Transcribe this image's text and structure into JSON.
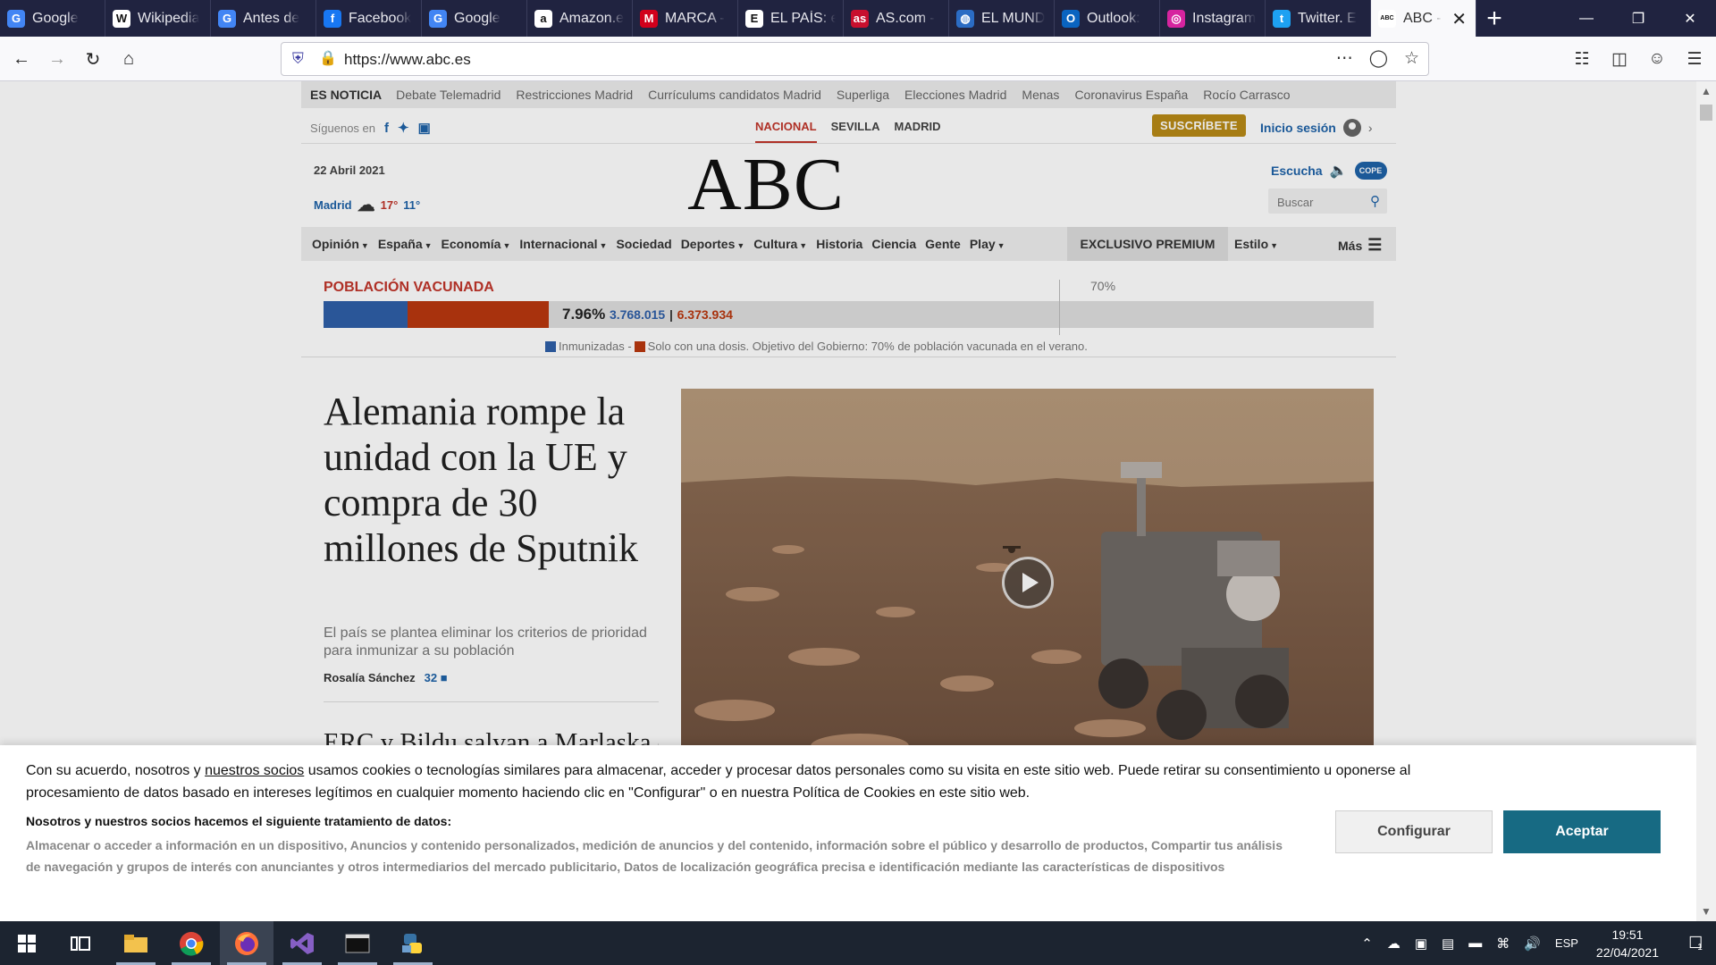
{
  "browser": {
    "tabs": [
      {
        "label": "Google",
        "icon": "google-icon",
        "color": "#4285f4",
        "glyph": "G"
      },
      {
        "label": "Wikipedia",
        "icon": "wikipedia-icon",
        "color": "#ffffff",
        "glyph": "W"
      },
      {
        "label": "Antes de",
        "icon": "google-icon",
        "color": "#4285f4",
        "glyph": "G"
      },
      {
        "label": "Facebook",
        "icon": "facebook-icon",
        "color": "#1877f2",
        "glyph": "f"
      },
      {
        "label": "Google",
        "icon": "google-icon",
        "color": "#4285f4",
        "glyph": "G"
      },
      {
        "label": "Amazon.e",
        "icon": "amazon-icon",
        "color": "#ffffff",
        "glyph": "a"
      },
      {
        "label": "MARCA -",
        "icon": "marca-icon",
        "color": "#d1001c",
        "glyph": "M"
      },
      {
        "label": "EL PAÍS: e",
        "icon": "elpais-icon",
        "color": "#ffffff",
        "glyph": "E"
      },
      {
        "label": "AS.com -",
        "icon": "as-icon",
        "color": "#c8102e",
        "glyph": "as"
      },
      {
        "label": "EL MUND",
        "icon": "globe-icon",
        "color": "#2b6cc4",
        "glyph": "◍"
      },
      {
        "label": "Outlook:",
        "icon": "outlook-icon",
        "color": "#0a64c0",
        "glyph": "O"
      },
      {
        "label": "Instagram",
        "icon": "instagram-icon",
        "color": "#d6249f",
        "glyph": "◎"
      },
      {
        "label": "Twitter. E",
        "icon": "twitter-icon",
        "color": "#1da1f2",
        "glyph": "t"
      },
      {
        "label": "ABC -",
        "icon": "abc-icon",
        "color": "#ffffff",
        "glyph": "ABC"
      }
    ],
    "url": "https://www.abc.es"
  },
  "ticker": {
    "label": "ES NOTICIA",
    "items": [
      "Debate Telemadrid",
      "Restricciones Madrid",
      "Currículums candidatos Madrid",
      "Superliga",
      "Elecciones Madrid",
      "Menas",
      "Coronavirus España",
      "Rocío Carrasco"
    ]
  },
  "social": {
    "follow_label": "Síguenos en"
  },
  "regions": [
    "NACIONAL",
    "SEVILLA",
    "MADRID"
  ],
  "subscribe_label": "SUSCRÍBETE",
  "login_label": "Inicio sesión",
  "masthead": {
    "date": "22 Abril 2021",
    "city": "Madrid",
    "temp_max": "17°",
    "temp_min": "11°",
    "logo": "ABC",
    "listen_label": "Escucha",
    "cope_label": "COPE",
    "search_placeholder": "Buscar"
  },
  "menu": {
    "items": [
      {
        "label": "Opinión",
        "dropdown": true
      },
      {
        "label": "España",
        "dropdown": true
      },
      {
        "label": "Economía",
        "dropdown": true
      },
      {
        "label": "Internacional",
        "dropdown": true
      },
      {
        "label": "Sociedad",
        "dropdown": false
      },
      {
        "label": "Deportes",
        "dropdown": true
      },
      {
        "label": "Cultura",
        "dropdown": true
      },
      {
        "label": "Historia",
        "dropdown": false
      },
      {
        "label": "Ciencia",
        "dropdown": false
      },
      {
        "label": "Gente",
        "dropdown": false
      },
      {
        "label": "Play",
        "dropdown": true
      }
    ],
    "premium_label": "EXCLUSIVO PREMIUM",
    "estilo_label": "Estilo",
    "more_label": "Más"
  },
  "vaccination": {
    "title": "POBLACIÓN VACUNADA",
    "target_label": "70%",
    "target_fraction": 0.7,
    "immunized_fraction": 0.0796,
    "single_dose_fraction": 0.1346,
    "percent": "7.96%",
    "immunized_count": "3.768.015",
    "single_dose_count": "6.373.934",
    "separator": "|",
    "legend_immunized": "Inmunizadas -",
    "legend_single": "Solo con una dosis. Objetivo del Gobierno: 70% de población vacunada en el verano.",
    "colors": {
      "immunized": "#2f5fa8",
      "single": "#b9380f"
    }
  },
  "article": {
    "headline": "Alemania rompe la unidad con la UE y compra de 30 millones de Sputnik",
    "deck": "El país se plantea eliminar los criterios de prioridad para inmunizar a su población",
    "author": "Rosalía Sánchez",
    "comments": "32",
    "second_headline": "ERC y Bildu salvan a Marlaska de"
  },
  "cookie": {
    "text_before": "Con su acuerdo, nosotros y ",
    "link": "nuestros socios",
    "text_after": " usamos cookies o tecnologías similares para almacenar, acceder y procesar datos personales como su visita en este sitio web. Puede retirar su consentimiento u oponerse al procesamiento de datos basado en intereses legítimos en cualquier momento haciendo clic en \"Configurar\" o en nuestra Política de Cookies en este sitio web.",
    "heading": "Nosotros y nuestros socios hacemos el siguiente tratamiento de datos:",
    "purposes": "Almacenar o acceder a información en un dispositivo, Anuncios y contenido personalizados, medición de anuncios y del contenido, información sobre el público y desarrollo de productos, Compartir tus análisis de navegación y grupos de interés con anunciantes y otros intermediarios del mercado publicitario, Datos de localización geográfica precisa e identificación mediante las características de dispositivos",
    "configure_label": "Configurar",
    "accept_label": "Aceptar"
  },
  "taskbar": {
    "language": "ESP",
    "time": "19:51",
    "date": "22/04/2021",
    "notifications": "1"
  }
}
